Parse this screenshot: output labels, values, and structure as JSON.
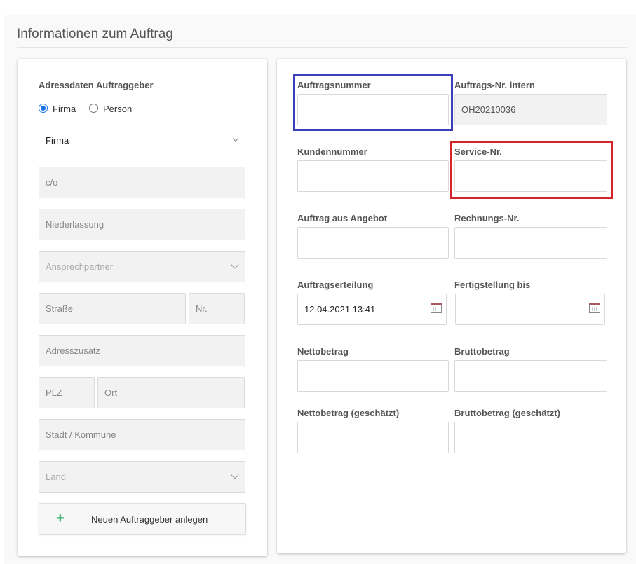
{
  "section": {
    "title": "Informationen zum Auftrag"
  },
  "left": {
    "heading": "Adressdaten Auftraggeber",
    "radios": [
      {
        "label": "Firma",
        "checked": true
      },
      {
        "label": "Person",
        "checked": false
      }
    ],
    "company_select_value": "Firma",
    "fields": {
      "co": "c/o",
      "niederlassung": "Niederlassung",
      "ansprechpartner": "Ansprechpartner",
      "strasse": "Straße",
      "nr": "Nr.",
      "adresszusatz": "Adresszusatz",
      "plz": "PLZ",
      "ort": "Ort",
      "stadt": "Stadt / Kommune",
      "land": "Land"
    },
    "add_button": "Neuen Auftraggeber anlegen"
  },
  "right": {
    "auftragsnummer": {
      "label": "Auftragsnummer",
      "value": ""
    },
    "auftrags_nr_intern": {
      "label": "Auftrags-Nr. intern",
      "value": "OH20210036"
    },
    "kundennummer": {
      "label": "Kundennummer",
      "value": ""
    },
    "service_nr": {
      "label": "Service-Nr.",
      "value": ""
    },
    "auftrag_aus_angebot": {
      "label": "Auftrag aus Angebot",
      "value": ""
    },
    "rechnungs_nr": {
      "label": "Rechnungs-Nr.",
      "value": ""
    },
    "auftragserteilung": {
      "label": "Auftragserteilung",
      "value": "12.04.2021 13:41"
    },
    "fertigstellung_bis": {
      "label": "Fertigstellung bis",
      "value": ""
    },
    "nettobetrag": {
      "label": "Nettobetrag",
      "value": ""
    },
    "bruttobetrag": {
      "label": "Bruttobetrag",
      "value": ""
    },
    "nettobetrag_geschaetzt": {
      "label": "Nettobetrag (geschätzt)",
      "value": ""
    },
    "bruttobetrag_geschaetzt": {
      "label": "Bruttobetrag (geschätzt)",
      "value": ""
    }
  },
  "highlights": {
    "blue": "#3b3fb8",
    "red": "#d6232a"
  },
  "colors": {
    "radio_accent": "#1a73e8",
    "add_icon": "#3cb371"
  }
}
